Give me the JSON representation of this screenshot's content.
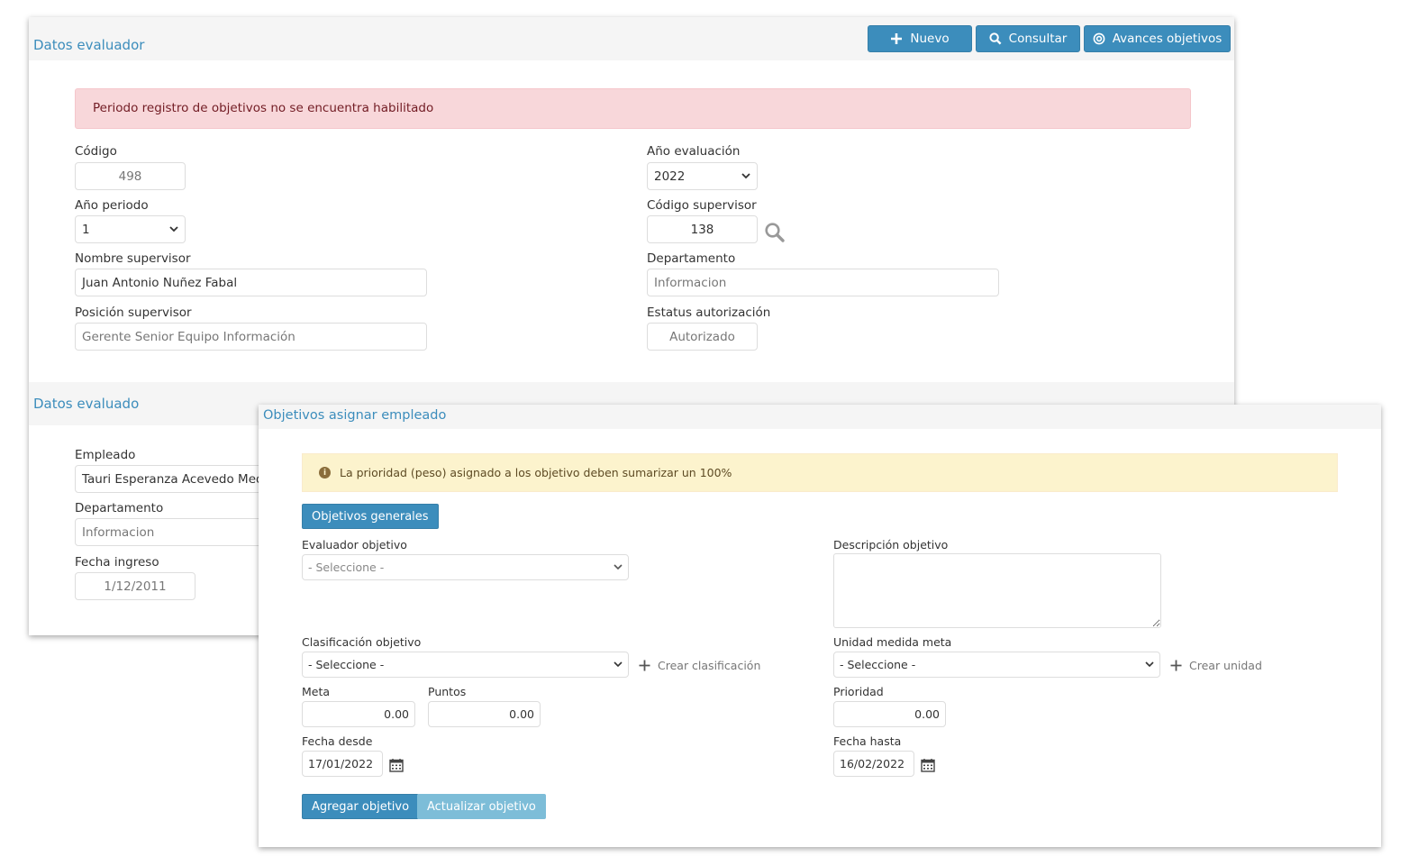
{
  "toolbar": {
    "nuevo": "Nuevo",
    "consultar": "Consultar",
    "avances": "Avances objetivos"
  },
  "evaluador": {
    "section_title": "Datos evaluador",
    "alert": "Periodo registro de objetivos no se encuentra habilitado",
    "codigo_label": "Código",
    "codigo_value": "498",
    "anio_eval_label": "Año evaluación",
    "anio_eval_value": "2022",
    "anio_periodo_label": "Año periodo",
    "anio_periodo_value": "1",
    "cod_sup_label": "Código supervisor",
    "cod_sup_value": "138",
    "nombre_sup_label": "Nombre supervisor",
    "nombre_sup_value": "Juan Antonio Nuñez Fabal",
    "depto_label": "Departamento",
    "depto_value": "Informacion",
    "posicion_label": "Posición supervisor",
    "posicion_value": "Gerente Senior Equipo Información",
    "estatus_label": "Estatus autorización",
    "estatus_value": "Autorizado"
  },
  "evaluado": {
    "section_title": "Datos evaluado",
    "empleado_label": "Empleado",
    "empleado_value": "Tauri Esperanza Acevedo Medi",
    "depto_label": "Departamento",
    "depto_value": "Informacion",
    "fecha_label": "Fecha ingreso",
    "fecha_value": "1/12/2011"
  },
  "objetivos": {
    "title": "Objetivos asignar empleado",
    "warning": "La prioridad (peso) asignado a los objetivo deben sumarizar un 100%",
    "generales_btn": "Objetivos generales",
    "evaluador_label": "Evaluador objetivo",
    "evaluador_value": "- Seleccione -",
    "descripcion_label": "Descripción objetivo",
    "clasif_label": "Clasificación objetivo",
    "clasif_value": "- Seleccione -",
    "crear_clasif": "Crear clasificación",
    "unidad_label": "Unidad medida meta",
    "unidad_value": "- Seleccione -",
    "crear_unidad": "Crear unidad",
    "meta_label": "Meta",
    "meta_value": "0.00",
    "puntos_label": "Puntos",
    "puntos_value": "0.00",
    "prioridad_label": "Prioridad",
    "prioridad_value": "0.00",
    "desde_label": "Fecha desde",
    "desde_value": "17/01/2022",
    "hasta_label": "Fecha hasta",
    "hasta_value": "16/02/2022",
    "agregar_btn": "Agregar objetivo",
    "actualizar_btn": "Actualizar objetivo"
  },
  "colors": {
    "primary": "#3c8dbc",
    "danger_bg": "#f8d7da",
    "warning_bg": "#fcf3cd"
  }
}
